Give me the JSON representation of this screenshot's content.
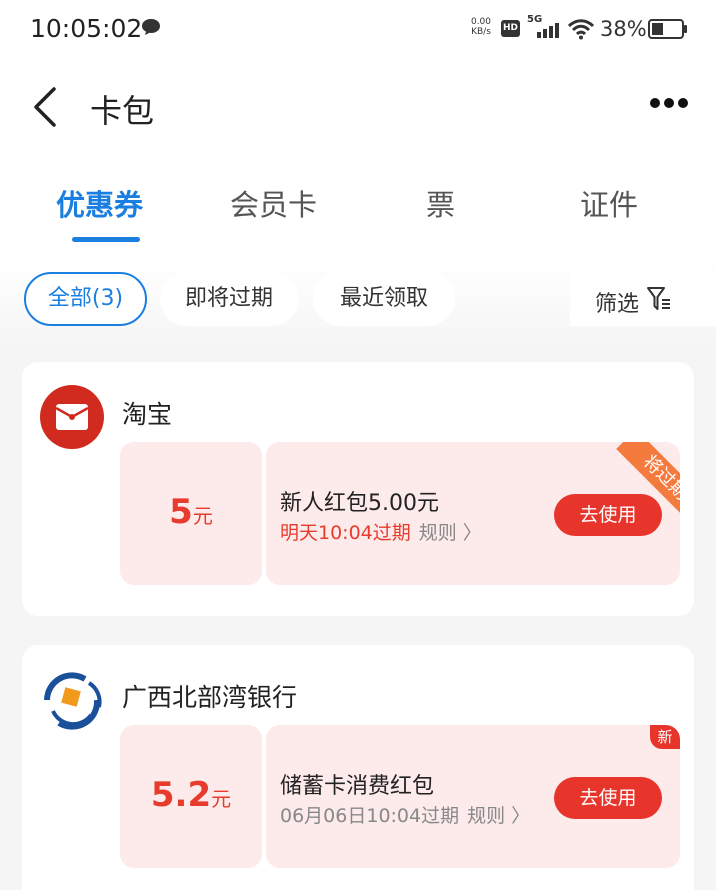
{
  "status_bar": {
    "time": "10:05:02",
    "net_speed": "0.00",
    "net_unit": "KB/s",
    "hd": "HD",
    "network": "5G",
    "battery": "38%"
  },
  "header": {
    "title": "卡包"
  },
  "tabs": [
    {
      "label": "优惠券",
      "active": true
    },
    {
      "label": "会员卡",
      "active": false
    },
    {
      "label": "票",
      "active": false
    },
    {
      "label": "证件",
      "active": false
    }
  ],
  "filters": {
    "chips": [
      {
        "label": "全部(3)",
        "selected": true
      },
      {
        "label": "即将过期",
        "selected": false
      },
      {
        "label": "最近领取",
        "selected": false
      }
    ],
    "filter_label": "筛选"
  },
  "cards": [
    {
      "merchant": "淘宝",
      "logo_icon": "taobao-red-envelope-icon",
      "coupon": {
        "amount": "5",
        "unit": "元",
        "name": "新人红包5.00元",
        "expiry": "明天10:04过期",
        "rules": "规则 〉",
        "button": "去使用",
        "ribbon": "将过期"
      }
    },
    {
      "merchant": "广西北部湾银行",
      "logo_icon": "bank-logo-icon",
      "coupon": {
        "amount": "5.2",
        "unit": "元",
        "name": "储蓄卡消费红包",
        "expiry": "06月06日10:04过期",
        "rules": "规则 〉",
        "button": "去使用",
        "badge": "新"
      }
    }
  ],
  "colors": {
    "accent": "#1a7fe0",
    "coupon_red": "#e73c2d",
    "button_red": "#e8352c",
    "coupon_bg": "#fdeaea",
    "ribbon": "#f47a3e"
  }
}
